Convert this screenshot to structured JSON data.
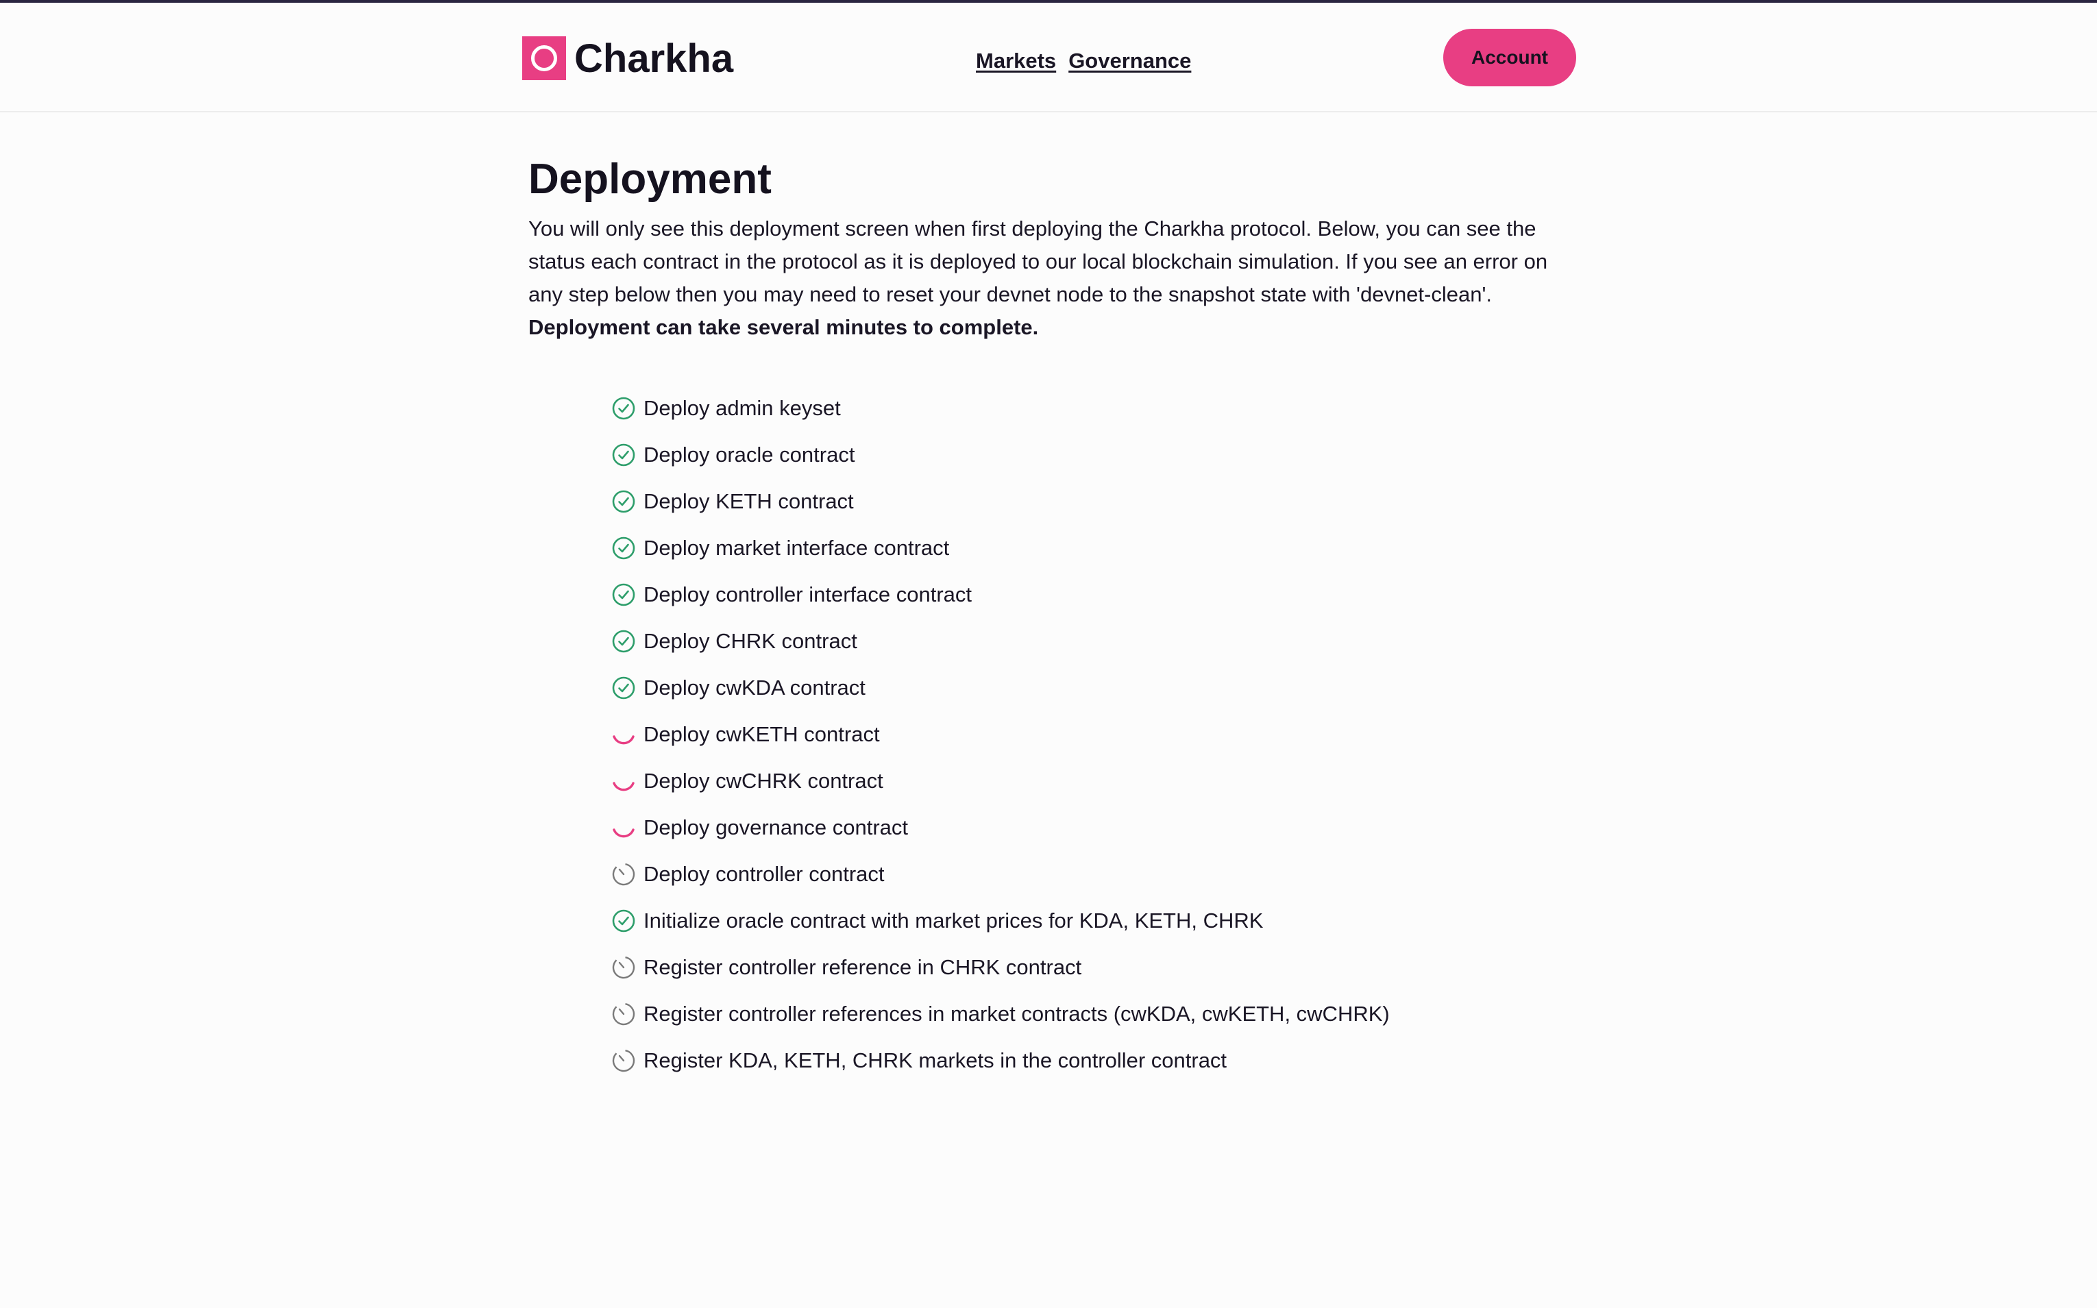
{
  "brand": {
    "name": "Charkha"
  },
  "nav": {
    "links": [
      {
        "label": "Markets"
      },
      {
        "label": "Governance"
      }
    ],
    "account_label": "Account"
  },
  "main": {
    "title": "Deployment",
    "intro": "You will only see this deployment screen when first deploying the Charkha protocol. Below, you can see the status each contract in the protocol as it is deployed to our local blockchain simulation. If you see an error on any step below then you may need to reset your devnet node to the snapshot state with 'devnet-clean'.",
    "intro_bold": "Deployment can take several minutes to complete.",
    "steps": [
      {
        "label": "Deploy admin keyset",
        "status": "done",
        "icon": "check-circle-icon"
      },
      {
        "label": "Deploy oracle contract",
        "status": "done",
        "icon": "check-circle-icon"
      },
      {
        "label": "Deploy KETH contract",
        "status": "done",
        "icon": "check-circle-icon"
      },
      {
        "label": "Deploy market interface contract",
        "status": "done",
        "icon": "check-circle-icon"
      },
      {
        "label": "Deploy controller interface contract",
        "status": "done",
        "icon": "check-circle-icon"
      },
      {
        "label": "Deploy CHRK contract",
        "status": "done",
        "icon": "check-circle-icon"
      },
      {
        "label": "Deploy cwKDA contract",
        "status": "done",
        "icon": "check-circle-icon"
      },
      {
        "label": "Deploy cwKETH contract",
        "status": "loading",
        "icon": "spinner-icon"
      },
      {
        "label": "Deploy cwCHRK contract",
        "status": "loading",
        "icon": "spinner-icon"
      },
      {
        "label": "Deploy governance contract",
        "status": "loading",
        "icon": "spinner-icon"
      },
      {
        "label": "Deploy controller contract",
        "status": "pending",
        "icon": "clock-icon"
      },
      {
        "label": "Initialize oracle contract with market prices for KDA, KETH, CHRK",
        "status": "done",
        "icon": "check-circle-icon"
      },
      {
        "label": "Register controller reference in CHRK contract",
        "status": "pending",
        "icon": "clock-icon"
      },
      {
        "label": "Register controller references in market contracts (cwKDA, cwKETH, cwCHRK)",
        "status": "pending",
        "icon": "clock-icon"
      },
      {
        "label": "Register KDA, KETH, CHRK markets in the controller contract",
        "status": "pending",
        "icon": "clock-icon"
      }
    ]
  },
  "colors": {
    "accent": "#e83e83",
    "success": "#2e9e6b",
    "pending": "#7a7a7a",
    "text": "#1a1625"
  }
}
